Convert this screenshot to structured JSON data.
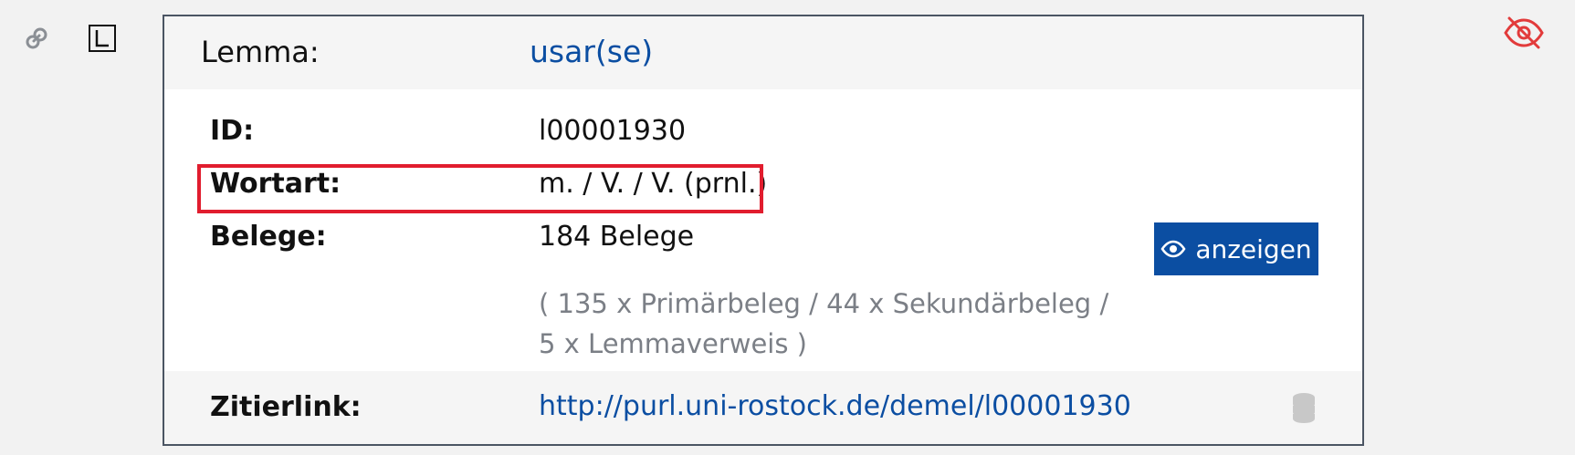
{
  "lemma": {
    "label": "Lemma:",
    "value": "usar(se)"
  },
  "fields": {
    "id": {
      "label": "ID:",
      "value": "l00001930"
    },
    "wortart": {
      "label": "Wortart:",
      "value": "m. / V. / V. (prnl.)"
    },
    "belege": {
      "label": "Belege:",
      "value": "184  Belege",
      "detail": "( 135 x Primärbeleg / 44 x Sekundärbeleg / 5 x Lemmaverweis )"
    }
  },
  "buttons": {
    "show_label": "anzeigen"
  },
  "footer": {
    "label": "Zitierlink:",
    "link": "http://purl.uni-rostock.de/demel/l00001930"
  },
  "icons": {
    "left": [
      "link-icon",
      "lemma-l-icon"
    ],
    "right": "eye-slash-icon",
    "footer": "database-icon"
  },
  "colors": {
    "accent": "#0b4ea2",
    "highlight": "#e11d2e",
    "hidden_icon": "#e23b3b"
  }
}
